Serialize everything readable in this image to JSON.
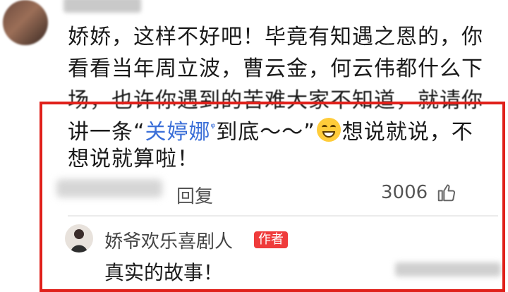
{
  "comment": {
    "line1": "娇娇，这样不好吧！毕竟有知遇之恩的，你",
    "line2": "看看当年周立波，曹云金，何云伟都什么下",
    "line3": "场，也许你遇到的苦难大家不知道，就请你",
    "line4_prefix": "讲一条“",
    "line4_highlight": "关婷娜",
    "line4_search_glyph": "🔍",
    "line4_middle": "到底～～”",
    "line4_suffix": "想说就说，不",
    "line5": "想说就算啦！",
    "emoji_icon": "grinning-face-emoji",
    "highlight_color": "#3b6fd8"
  },
  "actions": {
    "reply_label": "回复",
    "like_count": "3006",
    "like_icon": "thumbs-up-icon"
  },
  "reply": {
    "author": "娇爷欢乐喜剧人",
    "badge": "作者",
    "badge_color": "#ef3b3b",
    "text": "真实的故事！"
  },
  "annotation": {
    "box_color": "#e0201a"
  }
}
